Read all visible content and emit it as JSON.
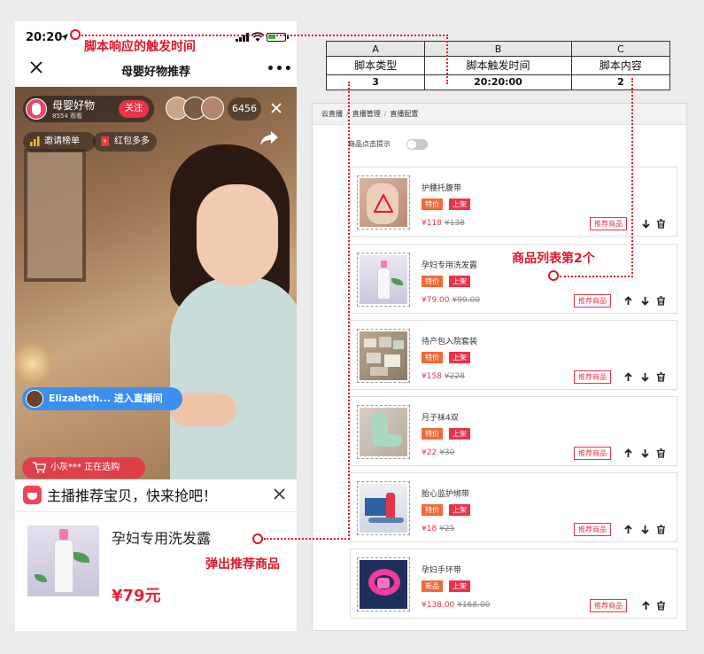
{
  "phone": {
    "status": {
      "time": "20:20"
    },
    "nav": {
      "title": "母婴好物推荐",
      "more": "•••"
    },
    "live": {
      "anchor_name": "母婴好物",
      "anchor_watch": "8554 观看",
      "follow_label": "关注",
      "viewer_count": "6456",
      "chip_rank": "邀请榜单",
      "chip_redpack": "红包多多",
      "enter_msg": "Elizabeth... 进入直播间",
      "buying_msg": "小灰*** 正在选购"
    },
    "popup": {
      "title": "主播推荐宝贝，快来抢吧！",
      "product_name": "孕妇专用洗发露",
      "product_price": "¥79元"
    }
  },
  "annotations": {
    "trigger_time": "脚本响应的触发时间",
    "list_second": "商品列表第2个",
    "popup_product": "弹出推荐商品"
  },
  "script_table": {
    "columns": [
      "A",
      "B",
      "C"
    ],
    "labels": [
      "脚本类型",
      "脚本触发时间",
      "脚本内容"
    ],
    "values": [
      "3",
      "20:20:00",
      "2"
    ]
  },
  "admin": {
    "breadcrumb": [
      "云直播",
      "直播管理",
      "直播配置"
    ],
    "toggle_label": "商品点击提示",
    "recommend_label": "推荐商品",
    "products": [
      {
        "name": "护腰托腹带",
        "tag1": "特价",
        "tag2": "上架",
        "price": "¥118",
        "orig_price": "¥138"
      },
      {
        "name": "孕妇专用洗发露",
        "tag1": "特价",
        "tag2": "上架",
        "price": "¥79.00",
        "orig_price": "¥99.00"
      },
      {
        "name": "待产包入院套装",
        "tag1": "特价",
        "tag2": "上架",
        "price": "¥158",
        "orig_price": "¥228"
      },
      {
        "name": "月子袜4双",
        "tag1": "特价",
        "tag2": "上架",
        "price": "¥22",
        "orig_price": "¥30"
      },
      {
        "name": "胎心监护绑带",
        "tag1": "特价",
        "tag2": "上架",
        "price": "¥18",
        "orig_price": "¥25"
      },
      {
        "name": "孕妇手环带",
        "tag1": "新品",
        "tag2": "上架",
        "price": "¥138.00",
        "orig_price": "¥168.00"
      }
    ]
  },
  "colors": {
    "accent_red": "#e0162b",
    "tag_orange": "#f06a3a",
    "tag_red": "#e8344a",
    "live_blue": "#3a8ff0"
  }
}
